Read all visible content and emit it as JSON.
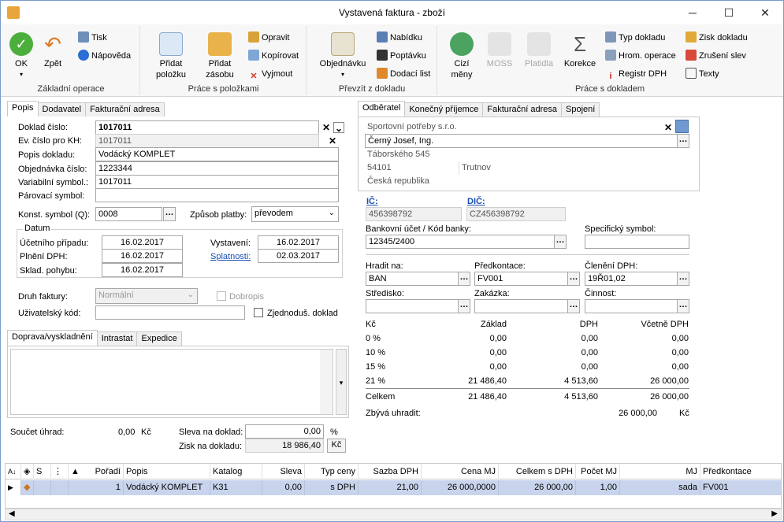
{
  "window": {
    "title": "Vystavená faktura - zboží"
  },
  "ribbon": {
    "groups": {
      "basic": "Základní operace",
      "items": "Práce s položkami",
      "transfer": "Převzít z dokladu",
      "doc": "Práce s dokladem"
    },
    "ok": "OK",
    "back": "Zpět",
    "print": "Tisk",
    "help": "Nápověda",
    "add_item": "Přidat\npoložku",
    "add_stock": "Přidat\nzásobu",
    "edit": "Opravit",
    "copy": "Kopírovat",
    "cut": "Vyjmout",
    "orders": "Objednávku",
    "offer": "Nabídku",
    "inquiry": "Poptávku",
    "delivery": "Dodací list",
    "foreign": "Cizí\nměny",
    "moss": "MOSS",
    "payments": "Platidla",
    "correction": "Korekce",
    "doc_type": "Typ dokladu",
    "bulk_op": "Hrom. operace",
    "vat_reg": "Registr DPH",
    "profit": "Zisk dokladu",
    "cancel_disc": "Zrušení slev",
    "texts": "Texty"
  },
  "left_tabs": [
    "Popis",
    "Dodavatel",
    "Fakturační adresa"
  ],
  "form": {
    "doc_no_label": "Doklad číslo:",
    "doc_no": "1017011",
    "ev_no_label": "Ev. číslo pro KH:",
    "ev_no": "1017011",
    "desc_label": "Popis dokladu:",
    "desc": "Vodácký KOMPLET",
    "order_no_label": "Objednávka číslo:",
    "order_no": "1223344",
    "var_sym_label": "Variabilní symbol.:",
    "var_sym": "1017011",
    "pair_sym_label": "Párovací symbol:",
    "pair_sym": "",
    "const_sym_label": "Konst. symbol (Q):",
    "const_sym": "0008",
    "payment_label": "Způsob platby:",
    "payment": "převodem",
    "dates_title": "Datum",
    "acct_date_label": "Účetního případu:",
    "acct_date": "16.02.2017",
    "vat_date_label": "Plnění DPH:",
    "vat_date": "16.02.2017",
    "stock_date_label": "Sklad. pohybu:",
    "stock_date": "16.02.2017",
    "issued_label": "Vystavení:",
    "issued": "16.02.2017",
    "due_label": "Splatnosti:",
    "due": "02.03.2017",
    "inv_type_label": "Druh faktury:",
    "inv_type": "Normální",
    "credit_label": "Dobropis",
    "user_code_label": "Uživatelský kód:",
    "user_code": "",
    "simplified_label": "Zjednoduš. doklad"
  },
  "lower_tabs": [
    "Doprava/vyskladnění",
    "Intrastat",
    "Expedice"
  ],
  "totals": {
    "paid_label": "Součet úhrad:",
    "paid": "0,00",
    "paid_cur": "Kč",
    "disc_label": "Sleva na doklad:",
    "disc": "0,00",
    "disc_unit": "%",
    "profit_label": "Zisk na dokladu:",
    "profit": "18 986,40",
    "profit_cur": "Kč"
  },
  "right_tabs": [
    "Odběratel",
    "Konečný příjemce",
    "Fakturační adresa",
    "Spojení"
  ],
  "customer": {
    "company": "Sportovní potřeby s.r.o.",
    "person": "Černý Josef, Ing.",
    "street": "Táborského 545",
    "zip": "54101",
    "city": "Trutnov",
    "country": "Česká republika",
    "ic_label": "IČ:",
    "ic": "456398792",
    "dic_label": "DIČ:",
    "dic": "CZ456398792",
    "bank_label": "Bankovní účet / Kód banky:",
    "bank": "12345/2400",
    "spec_sym_label": "Specifický symbol:",
    "spec_sym": "",
    "pay_to_label": "Hradit na:",
    "pay_to": "BAN",
    "precont_label": "Předkontace:",
    "precont": "FV001",
    "vat_split_label": "Členění DPH:",
    "vat_split": "19Ř01,02",
    "center_label": "Středisko:",
    "contract_label": "Zakázka:",
    "activity_label": "Činnost:"
  },
  "vat_table": {
    "headers": [
      "Kč",
      "Základ",
      "DPH",
      "Včetně DPH"
    ],
    "rows": [
      [
        "0 %",
        "0,00",
        "0,00",
        "0,00"
      ],
      [
        "10 %",
        "0,00",
        "0,00",
        "0,00"
      ],
      [
        "15 %",
        "0,00",
        "0,00",
        "0,00"
      ],
      [
        "21 %",
        "21 486,40",
        "4 513,60",
        "26 000,00"
      ]
    ],
    "total": [
      "Celkem",
      "21 486,40",
      "4 513,60",
      "26 000,00"
    ],
    "remaining_label": "Zbývá uhradit:",
    "remaining": "26 000,00",
    "remaining_cur": "Kč"
  },
  "grid": {
    "headers": [
      "S",
      "Pořadí",
      "Popis",
      "Katalog",
      "Sleva",
      "Typ ceny",
      "Sazba DPH",
      "Cena MJ",
      "Celkem s DPH",
      "Počet MJ",
      "MJ",
      "Předkontace"
    ],
    "row": [
      "",
      "1",
      "Vodácký KOMPLET",
      "K31",
      "0,00",
      "s DPH",
      "21,00",
      "26 000,0000",
      "26 000,00",
      "1,00",
      "sada",
      "FV001"
    ]
  }
}
